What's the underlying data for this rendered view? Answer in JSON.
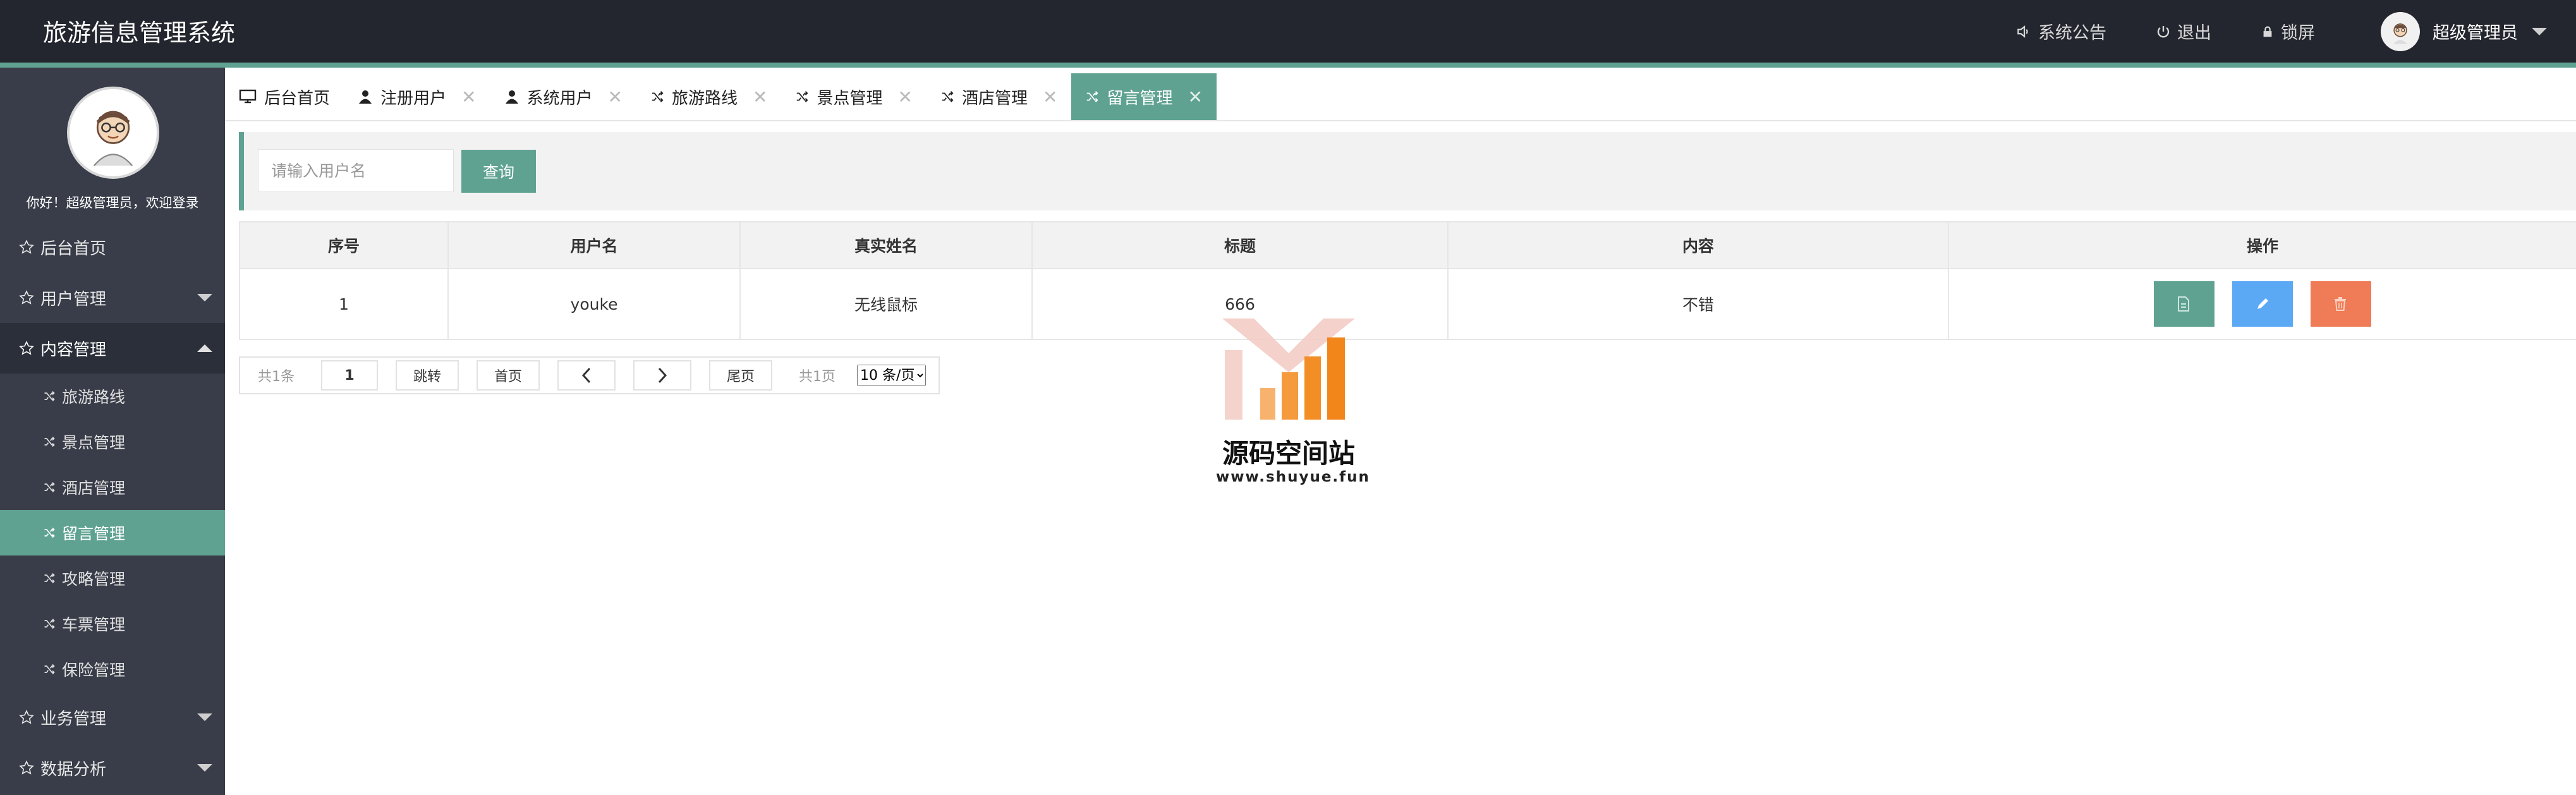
{
  "app": {
    "title": "旅游信息管理系统"
  },
  "topbar": {
    "announcement": "系统公告",
    "logout": "退出",
    "lock": "锁屏",
    "user": "超级管理员"
  },
  "sidebar": {
    "welcome": "你好！超级管理员，欢迎登录",
    "home": "后台首页",
    "user_mgmt": "用户管理",
    "content_mgmt": "内容管理",
    "sub_items": [
      "旅游路线",
      "景点管理",
      "酒店管理",
      "留言管理",
      "攻略管理",
      "车票管理",
      "保险管理"
    ],
    "business_mgmt": "业务管理",
    "data_analysis": "数据分析"
  },
  "tabs": [
    {
      "label": "后台首页"
    },
    {
      "label": "注册用户"
    },
    {
      "label": "系统用户"
    },
    {
      "label": "旅游路线"
    },
    {
      "label": "景点管理"
    },
    {
      "label": "酒店管理"
    },
    {
      "label": "留言管理"
    }
  ],
  "tab_close": "✕",
  "search": {
    "placeholder": "请输入用户名",
    "button": "查询"
  },
  "table": {
    "headers": [
      "序号",
      "用户名",
      "真实姓名",
      "标题",
      "内容",
      "操作"
    ],
    "rows": [
      {
        "index": "1",
        "username": "youke",
        "real_name": "无线鼠标",
        "title": "666",
        "content": "不错"
      }
    ]
  },
  "pager": {
    "total_items": "共1条",
    "page_input": "1",
    "jump": "跳转",
    "first": "首页",
    "last": "尾页",
    "total_pages": "共1页",
    "page_size": "10 条/页"
  },
  "watermark": {
    "title": "源码空间站",
    "url": "www.shuyue.fun"
  },
  "colors": {
    "accent": "#5fa291",
    "edit": "#5ba8f5",
    "delete": "#ef7c57",
    "topbar": "#23262e",
    "sidebar": "#393d49"
  }
}
